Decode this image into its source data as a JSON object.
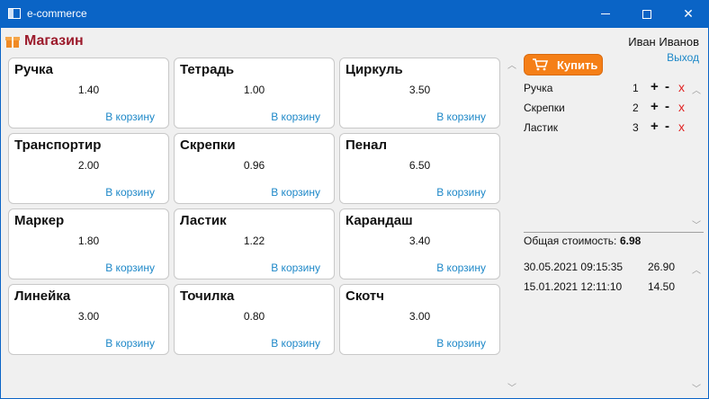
{
  "window": {
    "title": "e-commerce"
  },
  "header": {
    "brand": "Магазин",
    "user_name": "Иван Иванов",
    "logout": "Выход"
  },
  "products": [
    {
      "name": "Ручка",
      "price": "1.40",
      "add": "В корзину"
    },
    {
      "name": "Тетрадь",
      "price": "1.00",
      "add": "В корзину"
    },
    {
      "name": "Циркуль",
      "price": "3.50",
      "add": "В корзину"
    },
    {
      "name": "Транспортир",
      "price": "2.00",
      "add": "В корзину"
    },
    {
      "name": "Скрепки",
      "price": "0.96",
      "add": "В корзину"
    },
    {
      "name": "Пенал",
      "price": "6.50",
      "add": "В корзину"
    },
    {
      "name": "Маркер",
      "price": "1.80",
      "add": "В корзину"
    },
    {
      "name": "Ластик",
      "price": "1.22",
      "add": "В корзину"
    },
    {
      "name": "Карандаш",
      "price": "3.40",
      "add": "В корзину"
    },
    {
      "name": "Линейка",
      "price": "3.00",
      "add": "В корзину"
    },
    {
      "name": "Точилка",
      "price": "0.80",
      "add": "В корзину"
    },
    {
      "name": "Скотч",
      "price": "3.00",
      "add": "В корзину"
    }
  ],
  "cart": {
    "buy_label": "Купить",
    "items": [
      {
        "name": "Ручка",
        "qty": "1"
      },
      {
        "name": "Скрепки",
        "qty": "2"
      },
      {
        "name": "Ластик",
        "qty": "3"
      }
    ],
    "plus": "+",
    "minus": "-",
    "remove": "x",
    "total_label": "Общая стоимость:",
    "total_value": "6.98"
  },
  "history": [
    {
      "date": "30.05.2021 09:15:35",
      "sum": "26.90"
    },
    {
      "date": "15.01.2021 12:11:10",
      "sum": "14.50"
    }
  ],
  "colors": {
    "titlebar": "#0a64c6",
    "accent": "#f57f17",
    "link": "#1e88c8",
    "brand": "#9c1b2c",
    "remove": "#e02020"
  }
}
